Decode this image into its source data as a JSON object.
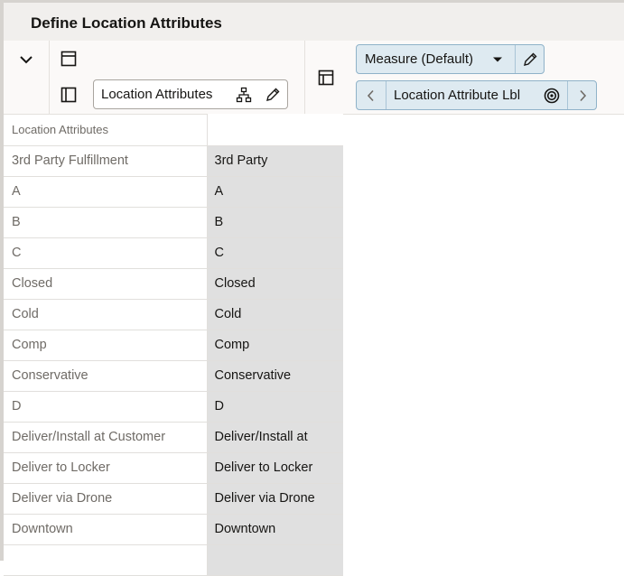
{
  "window": {
    "title": "Define Location Attributes"
  },
  "toolbar": {
    "rows_label": "Location Attributes",
    "measure_label": "Measure (Default)",
    "columns_label": "Location Attribute Lbl"
  },
  "grid": {
    "header": "Location Attributes",
    "rows": [
      {
        "label": "3rd Party Fulfillment",
        "value": "3rd Party"
      },
      {
        "label": "A",
        "value": "A"
      },
      {
        "label": "B",
        "value": "B"
      },
      {
        "label": "C",
        "value": "C"
      },
      {
        "label": "Closed",
        "value": "Closed"
      },
      {
        "label": "Cold",
        "value": "Cold"
      },
      {
        "label": "Comp",
        "value": "Comp"
      },
      {
        "label": "Conservative",
        "value": "Conservative"
      },
      {
        "label": "D",
        "value": "D"
      },
      {
        "label": "Deliver/Install at Customer",
        "value": "Deliver/Install at"
      },
      {
        "label": "Deliver to Locker",
        "value": "Deliver to Locker"
      },
      {
        "label": "Deliver via Drone",
        "value": "Deliver via Drone"
      },
      {
        "label": "Downtown",
        "value": "Downtown"
      },
      {
        "label": "",
        "value": ""
      }
    ]
  }
}
